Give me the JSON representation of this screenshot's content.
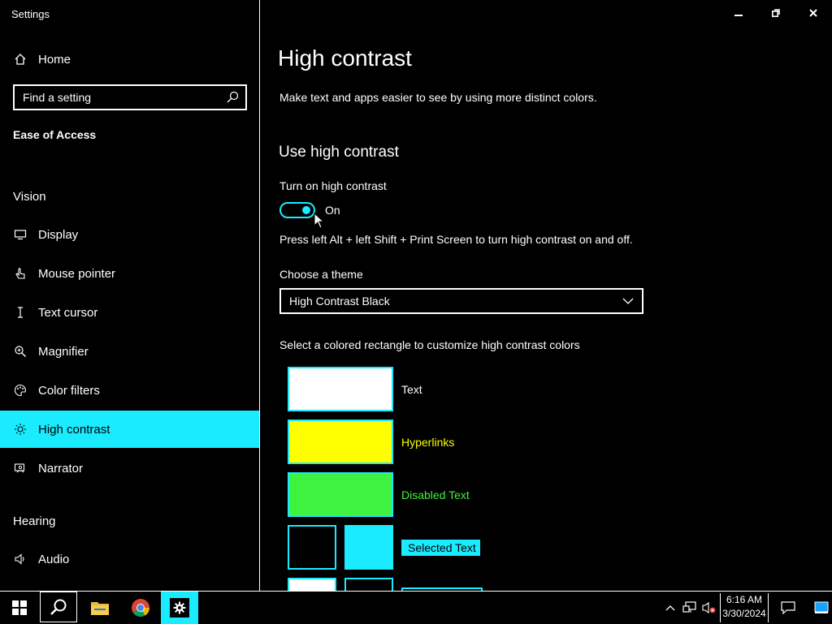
{
  "window": {
    "title": "Settings"
  },
  "sidebar": {
    "home": "Home",
    "search_placeholder": "Find a setting",
    "category": "Ease of Access",
    "vision_header": "Vision",
    "items": [
      {
        "label": "Display",
        "icon": "monitor-icon"
      },
      {
        "label": "Mouse pointer",
        "icon": "hand-pointer-icon"
      },
      {
        "label": "Text cursor",
        "icon": "text-cursor-icon"
      },
      {
        "label": "Magnifier",
        "icon": "magnifier-icon"
      },
      {
        "label": "Color filters",
        "icon": "palette-icon"
      },
      {
        "label": "High contrast",
        "icon": "sun-icon"
      },
      {
        "label": "Narrator",
        "icon": "narrator-icon"
      }
    ],
    "hearing_header": "Hearing",
    "audio": "Audio"
  },
  "main": {
    "page_title": "High contrast",
    "description": "Make text and apps easier to see by using more distinct colors.",
    "section_title": "Use high contrast",
    "toggle_label": "Turn on high contrast",
    "toggle_state": "On",
    "shortcut_text": "Press left Alt + left Shift + Print Screen to turn high contrast on and off.",
    "theme_label": "Choose a theme",
    "theme_value": "High Contrast Black",
    "customize_text": "Select a colored rectangle to customize high contrast colors",
    "colors": {
      "text": {
        "label": "Text",
        "swatch": "#ffffff",
        "label_color": "#ffffff"
      },
      "hyperlinks": {
        "label": "Hyperlinks",
        "swatch": "#ffff00",
        "label_color": "#ffff00"
      },
      "disabled": {
        "label": "Disabled Text",
        "swatch": "#3ff23f",
        "label_color": "#3ff23f"
      },
      "selected": {
        "label": "Selected Text",
        "bg_swatch": "#000000",
        "fg_swatch": "#1aebff"
      }
    }
  },
  "accent": "#1aebff",
  "taskbar": {
    "time": "6:16 AM",
    "date": "3/30/2024"
  }
}
